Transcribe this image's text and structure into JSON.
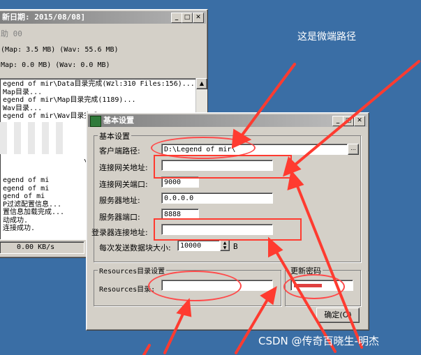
{
  "bg_window": {
    "title": "新日期: 2015/08/08]",
    "menu": "助 00",
    "stat1": "(Map: 3.5 MB) (Wav: 55.6 MB)",
    "stat2": "Map: 0.0 MB) (Wav: 0.0 MB)",
    "log": [
      "egend of mir\\Data目录完成(Wzl:310 Files:156)...",
      "Map目录...",
      "egend of mir\\Map目录完成(1189)...",
      "Wav目录...",
      "egend of mir\\Wav目录完成",
      "",
      "egend of m",
      "",
      "",
      "",
      "",
      "",
      "egend of mi",
      "egend of mi",
      "gend of mi",
      "P过滤配置信息...",
      "置信息加载完成...",
      "动成功.",
      "连接成功."
    ],
    "log_extra": "\\W",
    "speed": "0.00 KB/s"
  },
  "dialog": {
    "title": "基本设置",
    "basic_group": "基本设置",
    "client_path_label": "客户端路径:",
    "client_path_value": "D:\\Legend of mir\\",
    "browse_label": "...",
    "gateway_addr_label": "连接网关地址:",
    "gateway_addr_value": "",
    "gateway_port_label": "连接网关端口:",
    "gateway_port_value": "9000",
    "server_addr_label": "服务器地址:",
    "server_addr_value": "0.0.0.0",
    "server_port_label": "服务器端口:",
    "server_port_value": "8888",
    "login_addr_label": "登录器连接地址:",
    "login_addr_value": "",
    "block_size_label": "每次发送数据块大小:",
    "block_size_value": "10000",
    "block_size_unit": "B",
    "resources_group": "Resources目录设置",
    "resources_dir_label": "Resources目录:",
    "resources_dir_value": "",
    "password_group": "更新密码",
    "ok_label": "确定(O)"
  },
  "annotation": {
    "text": "这是微端路径"
  },
  "watermark": "CSDN @传奇百晓生-明杰",
  "colors": {
    "desktop": "#3a6ea5",
    "annotation_red": "#ff3b30",
    "window_face": "#d4d0c8"
  }
}
